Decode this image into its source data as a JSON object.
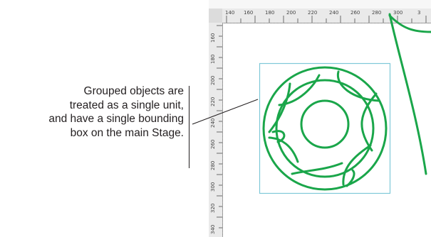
{
  "callout": {
    "lines": [
      "Grouped objects are",
      "treated as a single unit,",
      "and have a single bounding",
      "box on the main Stage."
    ]
  },
  "ruler": {
    "top_labels": [
      "140",
      "160",
      "180",
      "200",
      "220",
      "240",
      "260",
      "280",
      "300",
      "3"
    ],
    "left_labels": [
      "160",
      "180",
      "200",
      "220",
      "240",
      "260",
      "280",
      "300",
      "320",
      "340"
    ]
  },
  "colors": {
    "object_stroke": "#1aa64a",
    "bounding_box": "#7fc8d8",
    "ruler_bg": "#eaeaea"
  }
}
